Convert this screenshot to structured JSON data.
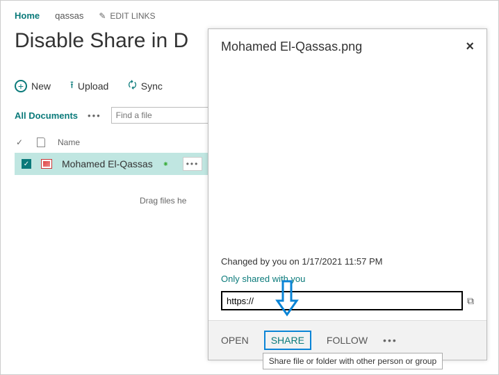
{
  "breadcrumb": {
    "home": "Home",
    "site": "qassas",
    "edit_links": "EDIT LINKS"
  },
  "page_title": "Disable Share in D",
  "toolbar": {
    "new": "New",
    "upload": "Upload",
    "sync": "Sync"
  },
  "view": {
    "name": "All Documents",
    "find_placeholder": "Find a file"
  },
  "list": {
    "col_name": "Name",
    "items": [
      {
        "title": "Mohamed El-Qassas"
      }
    ],
    "drag_hint": "Drag files he"
  },
  "panel": {
    "title": "Mohamed El-Qassas.png",
    "changed_by": "Changed by you on 1/17/2021 11:57 PM",
    "shared_with": "Only shared with you",
    "url_value": "https://",
    "actions": {
      "open": "OPEN",
      "share": "SHARE",
      "follow": "FOLLOW"
    },
    "tooltip": "Share file or folder with other person or group"
  }
}
